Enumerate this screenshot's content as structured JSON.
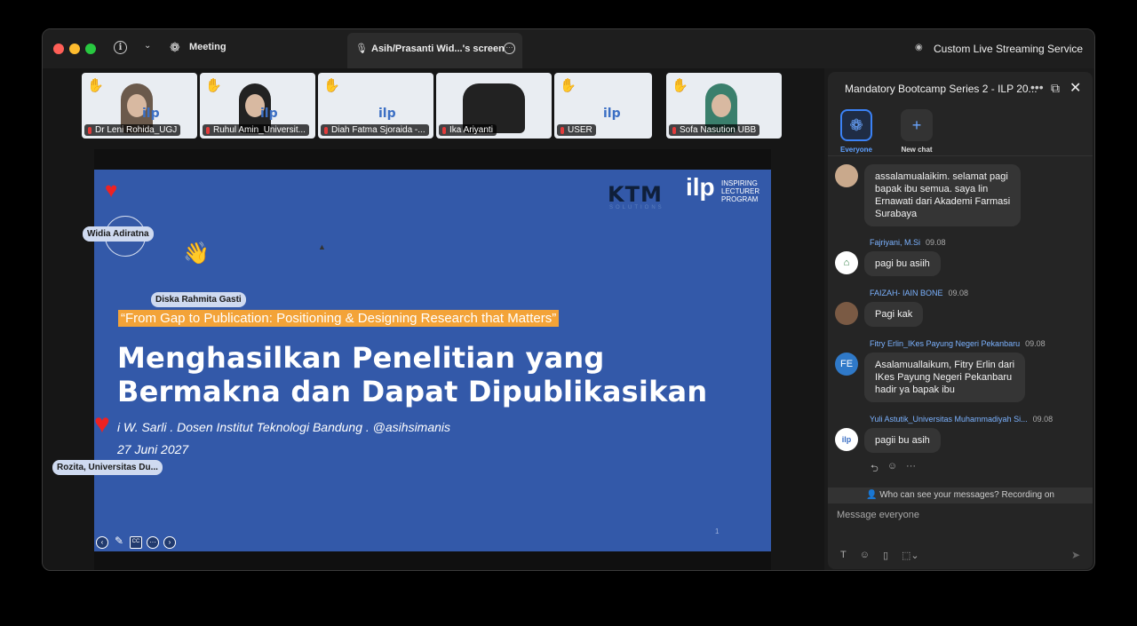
{
  "titlebar": {
    "meeting_label": "Meeting",
    "screen_tab_label": "Asih/Prasanti Wid...'s screen",
    "streaming_label": "Custom Live Streaming Service"
  },
  "participants": [
    {
      "name": "Dr Leni Rohida_UGJ",
      "hand": "✋"
    },
    {
      "name": "Ruhul Amin_Universit...",
      "hand": "✋"
    },
    {
      "name": "Diah Fatma Sjoraida -...",
      "hand": "✋"
    },
    {
      "name": "Ika Ariyanti",
      "hand": ""
    },
    {
      "name": "USER",
      "hand": "✋"
    },
    {
      "name": "Sofa Nasution UBB",
      "hand": "✋"
    }
  ],
  "overlays": {
    "widia": "Widia Adiratna",
    "diska": "Diska Rahmita Gasti",
    "rozita": "Rozita, Universitas Du..."
  },
  "slide": {
    "ktm_logo": "KTM",
    "ktm_sub": "SOLUTIONS",
    "ilp_logo": "ilp",
    "ilp_text_1": "INSPIRING",
    "ilp_text_2": "LECTURER",
    "ilp_text_3": "PROGRAM",
    "quote": "“From Gap to Publication: Positioning & Designing Research that Matters”",
    "title_line1": "Menghasilkan Penelitian yang",
    "title_line2": "Bermakna dan Dapat Dipublikasikan",
    "author": "i W. Sarli . Dosen Institut Teknologi Bandung . @asihsimanis",
    "date": "27 Juni 2027",
    "page_number": "1"
  },
  "chat": {
    "title": "Mandatory Bootcamp Series 2 - ILP 20...",
    "rooms": [
      {
        "label": "Everyone"
      },
      {
        "label": "New chat"
      }
    ],
    "messages": [
      {
        "sender": "",
        "time": "",
        "text_lines": [
          "assalamualaikim. selamat pagi",
          "bapak ibu semua. saya lin",
          "Ernawati dari Akademi Farmasi",
          "Surabaya"
        ]
      },
      {
        "sender": "Fajriyani, M.Si",
        "time": "09.08",
        "text_lines": [
          "pagi bu asiih"
        ]
      },
      {
        "sender": "FAIZAH- IAIN BONE",
        "time": "09.08",
        "text_lines": [
          "Pagi kak"
        ]
      },
      {
        "sender": "Fitry Erlin_IKes Payung Negeri Pekanbaru",
        "time": "09.08",
        "avatar_initials": "FE",
        "text_lines": [
          "Asalamuallaikum, Fitry Erlin dari",
          "IKes Payung Negeri Pekanbaru",
          "hadir ya bapak ibu"
        ]
      },
      {
        "sender": "Yuli Astutik_Universitas Muhammadiyah Si...",
        "time": "09.08",
        "text_lines": [
          "pagii bu asih"
        ]
      }
    ],
    "notice": "Who can see your messages? Recording on",
    "compose_placeholder": "Message everyone"
  }
}
